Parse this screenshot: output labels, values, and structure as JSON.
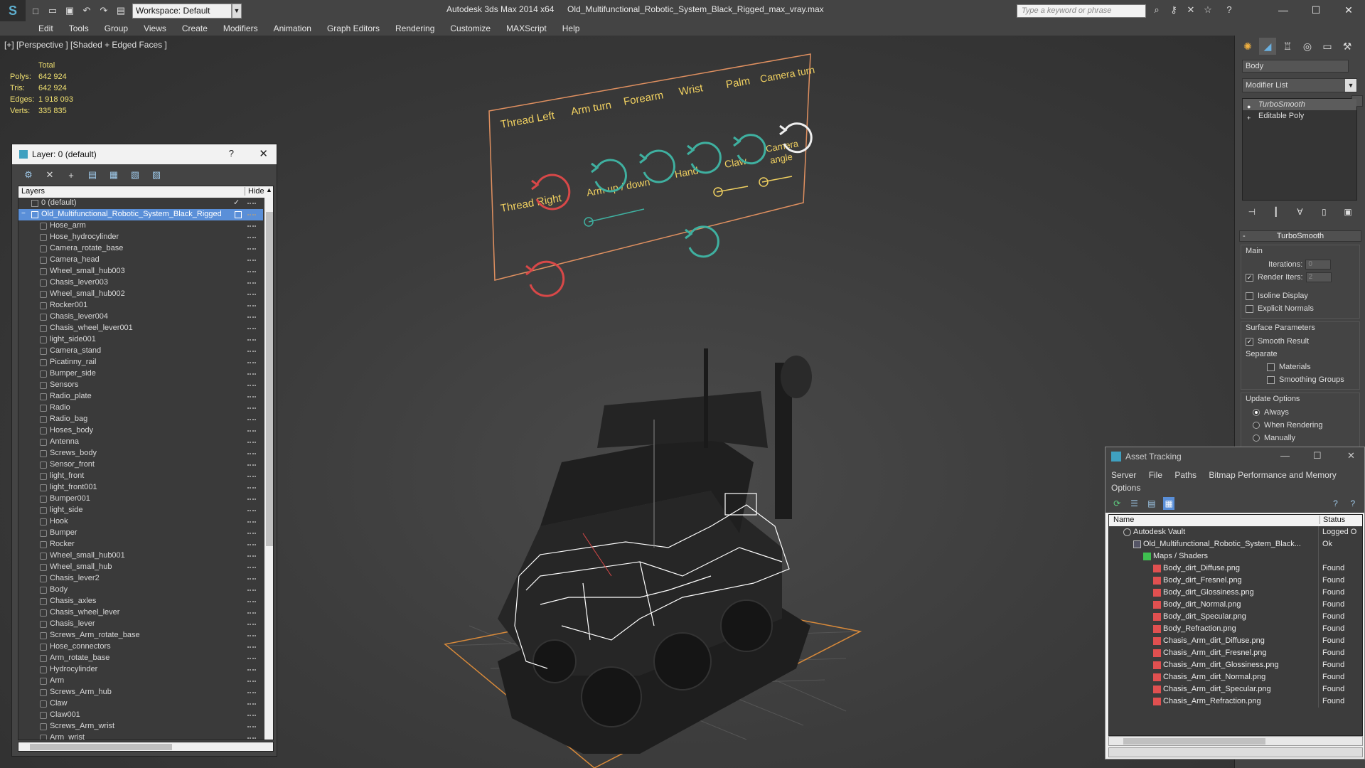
{
  "titlebar": {
    "workspace": "Workspace: Default",
    "app_title": "Autodesk 3ds Max  2014 x64",
    "doc_title": "Old_Multifunctional_Robotic_System_Black_Rigged_max_vray.max",
    "search_placeholder": "Type a keyword or phrase"
  },
  "menus": [
    "Edit",
    "Tools",
    "Group",
    "Views",
    "Create",
    "Modifiers",
    "Animation",
    "Graph Editors",
    "Rendering",
    "Customize",
    "MAXScript",
    "Help"
  ],
  "viewport": {
    "label": "[+] [Perspective ] [Shaded + Edged Faces ]",
    "stats": {
      "header": "Total",
      "rows": [
        {
          "label": "Polys:",
          "value": "642 924"
        },
        {
          "label": "Tris:",
          "value": "642 924"
        },
        {
          "label": "Edges:",
          "value": "1 918 093"
        },
        {
          "label": "Verts:",
          "value": "335 835"
        }
      ]
    },
    "rig_panel": {
      "labels": [
        "Thread Left",
        "Arm turn",
        "Forearm",
        "Wrist",
        "Palm",
        "Camera turn",
        "Thread Right",
        "Arm up / down",
        "Hand",
        "Claw",
        "Camera",
        "angle"
      ]
    }
  },
  "layer_dialog": {
    "title": "Layer: 0 (default)",
    "help": "?",
    "col_layers": "Layers",
    "col_hide": "Hide",
    "default_layer": "0 (default)",
    "selected_layer": "Old_Multifunctional_Robotic_System_Black_Rigged",
    "objects": [
      "Hose_arm",
      "Hose_hydrocylinder",
      "Camera_rotate_base",
      "Camera_head",
      "Wheel_small_hub003",
      "Chasis_lever003",
      "Wheel_small_hub002",
      "Rocker001",
      "Chasis_lever004",
      "Chasis_wheel_lever001",
      "light_side001",
      "Camera_stand",
      "Picatinny_rail",
      "Bumper_side",
      "Sensors",
      "Radio_plate",
      "Radio",
      "Radio_bag",
      "Hoses_body",
      "Antenna",
      "Screws_body",
      "Sensor_front",
      "light_front",
      "light_front001",
      "Bumper001",
      "light_side",
      "Hook",
      "Bumper",
      "Rocker",
      "Wheel_small_hub001",
      "Wheel_small_hub",
      "Chasis_lever2",
      "Body",
      "Chasis_axles",
      "Chasis_wheel_lever",
      "Chasis_lever",
      "Screws_Arm_rotate_base",
      "Hose_connectors",
      "Arm_rotate_base",
      "Hydrocylinder",
      "Arm",
      "Screws_Arm_hub",
      "Claw",
      "Claw001",
      "Screws_Arm_wrist",
      "Arm_wrist"
    ]
  },
  "command_panel": {
    "object_name": "Body",
    "modifier_list": "Modifier List",
    "stack": [
      "TurboSmooth",
      "Editable Poly"
    ],
    "rollout_title": "TurboSmooth",
    "main_group": "Main",
    "iterations_label": "Iterations:",
    "iterations_value": "0",
    "render_iters_label": "Render Iters:",
    "render_iters_value": "2",
    "render_iters_checked": true,
    "isoline_label": "Isoline Display",
    "explicit_normals_label": "Explicit Normals",
    "surface_group": "Surface Parameters",
    "smooth_result_label": "Smooth Result",
    "separate_label": "Separate",
    "materials_label": "Materials",
    "smoothing_groups_label": "Smoothing Groups",
    "update_group": "Update Options",
    "update_options": [
      "Always",
      "When Rendering",
      "Manually"
    ],
    "update_selected": "Always"
  },
  "asset_tracking": {
    "title": "Asset Tracking",
    "menu": [
      "Server",
      "File",
      "Paths",
      "Bitmap Performance and Memory"
    ],
    "menu2": "Options",
    "col_name": "Name",
    "col_status": "Status",
    "vault": {
      "name": "Autodesk Vault",
      "status": "Logged O"
    },
    "file": {
      "name": "Old_Multifunctional_Robotic_System_Black...",
      "status": "Ok"
    },
    "maps_folder": "Maps / Shaders",
    "maps": [
      {
        "name": "Body_dirt_Diffuse.png",
        "status": "Found"
      },
      {
        "name": "Body_dirt_Fresnel.png",
        "status": "Found"
      },
      {
        "name": "Body_dirt_Glossiness.png",
        "status": "Found"
      },
      {
        "name": "Body_dirt_Normal.png",
        "status": "Found"
      },
      {
        "name": "Body_dirt_Specular.png",
        "status": "Found"
      },
      {
        "name": "Body_Refraction.png",
        "status": "Found"
      },
      {
        "name": "Chasis_Arm_dirt_Diffuse.png",
        "status": "Found"
      },
      {
        "name": "Chasis_Arm_dirt_Fresnel.png",
        "status": "Found"
      },
      {
        "name": "Chasis_Arm_dirt_Glossiness.png",
        "status": "Found"
      },
      {
        "name": "Chasis_Arm_dirt_Normal.png",
        "status": "Found"
      },
      {
        "name": "Chasis_Arm_dirt_Specular.png",
        "status": "Found"
      },
      {
        "name": "Chasis_Arm_Refraction.png",
        "status": "Found"
      }
    ]
  },
  "colors": {
    "accent_selection": "#5a8fd8",
    "stats_text": "#f0e070",
    "rig_border": "#e09060",
    "rig_red": "#d84848",
    "rig_teal": "#3fb0a0",
    "rig_label": "#f0d060"
  }
}
